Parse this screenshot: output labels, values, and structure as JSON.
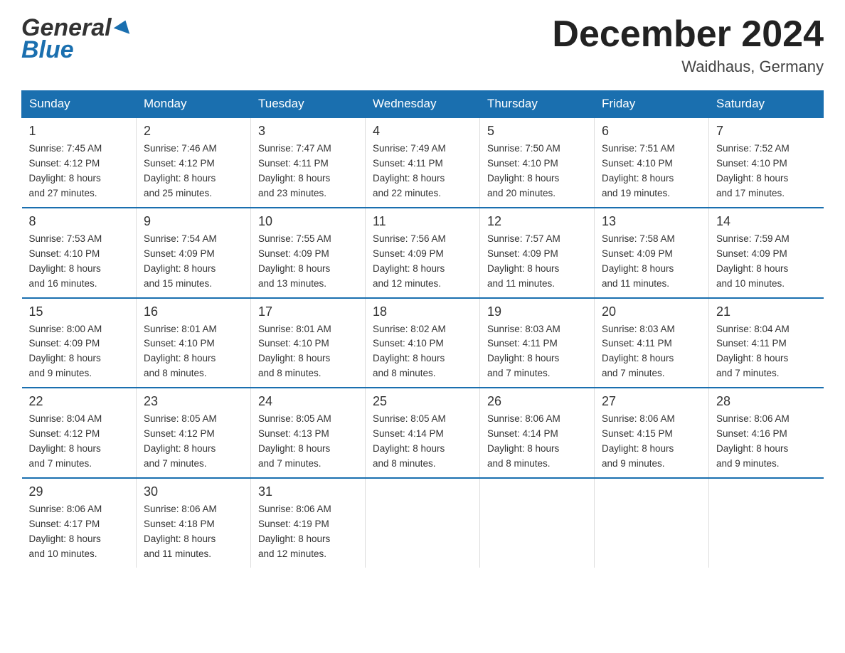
{
  "header": {
    "logo_general": "General",
    "logo_blue": "Blue",
    "month_title": "December 2024",
    "location": "Waidhaus, Germany"
  },
  "days_header": [
    "Sunday",
    "Monday",
    "Tuesday",
    "Wednesday",
    "Thursday",
    "Friday",
    "Saturday"
  ],
  "weeks": [
    [
      {
        "day": "1",
        "sunrise": "7:45 AM",
        "sunset": "4:12 PM",
        "daylight": "8 hours and 27 minutes."
      },
      {
        "day": "2",
        "sunrise": "7:46 AM",
        "sunset": "4:12 PM",
        "daylight": "8 hours and 25 minutes."
      },
      {
        "day": "3",
        "sunrise": "7:47 AM",
        "sunset": "4:11 PM",
        "daylight": "8 hours and 23 minutes."
      },
      {
        "day": "4",
        "sunrise": "7:49 AM",
        "sunset": "4:11 PM",
        "daylight": "8 hours and 22 minutes."
      },
      {
        "day": "5",
        "sunrise": "7:50 AM",
        "sunset": "4:10 PM",
        "daylight": "8 hours and 20 minutes."
      },
      {
        "day": "6",
        "sunrise": "7:51 AM",
        "sunset": "4:10 PM",
        "daylight": "8 hours and 19 minutes."
      },
      {
        "day": "7",
        "sunrise": "7:52 AM",
        "sunset": "4:10 PM",
        "daylight": "8 hours and 17 minutes."
      }
    ],
    [
      {
        "day": "8",
        "sunrise": "7:53 AM",
        "sunset": "4:10 PM",
        "daylight": "8 hours and 16 minutes."
      },
      {
        "day": "9",
        "sunrise": "7:54 AM",
        "sunset": "4:09 PM",
        "daylight": "8 hours and 15 minutes."
      },
      {
        "day": "10",
        "sunrise": "7:55 AM",
        "sunset": "4:09 PM",
        "daylight": "8 hours and 13 minutes."
      },
      {
        "day": "11",
        "sunrise": "7:56 AM",
        "sunset": "4:09 PM",
        "daylight": "8 hours and 12 minutes."
      },
      {
        "day": "12",
        "sunrise": "7:57 AM",
        "sunset": "4:09 PM",
        "daylight": "8 hours and 11 minutes."
      },
      {
        "day": "13",
        "sunrise": "7:58 AM",
        "sunset": "4:09 PM",
        "daylight": "8 hours and 11 minutes."
      },
      {
        "day": "14",
        "sunrise": "7:59 AM",
        "sunset": "4:09 PM",
        "daylight": "8 hours and 10 minutes."
      }
    ],
    [
      {
        "day": "15",
        "sunrise": "8:00 AM",
        "sunset": "4:09 PM",
        "daylight": "8 hours and 9 minutes."
      },
      {
        "day": "16",
        "sunrise": "8:01 AM",
        "sunset": "4:10 PM",
        "daylight": "8 hours and 8 minutes."
      },
      {
        "day": "17",
        "sunrise": "8:01 AM",
        "sunset": "4:10 PM",
        "daylight": "8 hours and 8 minutes."
      },
      {
        "day": "18",
        "sunrise": "8:02 AM",
        "sunset": "4:10 PM",
        "daylight": "8 hours and 8 minutes."
      },
      {
        "day": "19",
        "sunrise": "8:03 AM",
        "sunset": "4:11 PM",
        "daylight": "8 hours and 7 minutes."
      },
      {
        "day": "20",
        "sunrise": "8:03 AM",
        "sunset": "4:11 PM",
        "daylight": "8 hours and 7 minutes."
      },
      {
        "day": "21",
        "sunrise": "8:04 AM",
        "sunset": "4:11 PM",
        "daylight": "8 hours and 7 minutes."
      }
    ],
    [
      {
        "day": "22",
        "sunrise": "8:04 AM",
        "sunset": "4:12 PM",
        "daylight": "8 hours and 7 minutes."
      },
      {
        "day": "23",
        "sunrise": "8:05 AM",
        "sunset": "4:12 PM",
        "daylight": "8 hours and 7 minutes."
      },
      {
        "day": "24",
        "sunrise": "8:05 AM",
        "sunset": "4:13 PM",
        "daylight": "8 hours and 7 minutes."
      },
      {
        "day": "25",
        "sunrise": "8:05 AM",
        "sunset": "4:14 PM",
        "daylight": "8 hours and 8 minutes."
      },
      {
        "day": "26",
        "sunrise": "8:06 AM",
        "sunset": "4:14 PM",
        "daylight": "8 hours and 8 minutes."
      },
      {
        "day": "27",
        "sunrise": "8:06 AM",
        "sunset": "4:15 PM",
        "daylight": "8 hours and 9 minutes."
      },
      {
        "day": "28",
        "sunrise": "8:06 AM",
        "sunset": "4:16 PM",
        "daylight": "8 hours and 9 minutes."
      }
    ],
    [
      {
        "day": "29",
        "sunrise": "8:06 AM",
        "sunset": "4:17 PM",
        "daylight": "8 hours and 10 minutes."
      },
      {
        "day": "30",
        "sunrise": "8:06 AM",
        "sunset": "4:18 PM",
        "daylight": "8 hours and 11 minutes."
      },
      {
        "day": "31",
        "sunrise": "8:06 AM",
        "sunset": "4:19 PM",
        "daylight": "8 hours and 12 minutes."
      },
      null,
      null,
      null,
      null
    ]
  ],
  "labels": {
    "sunrise": "Sunrise:",
    "sunset": "Sunset:",
    "daylight": "Daylight:"
  }
}
